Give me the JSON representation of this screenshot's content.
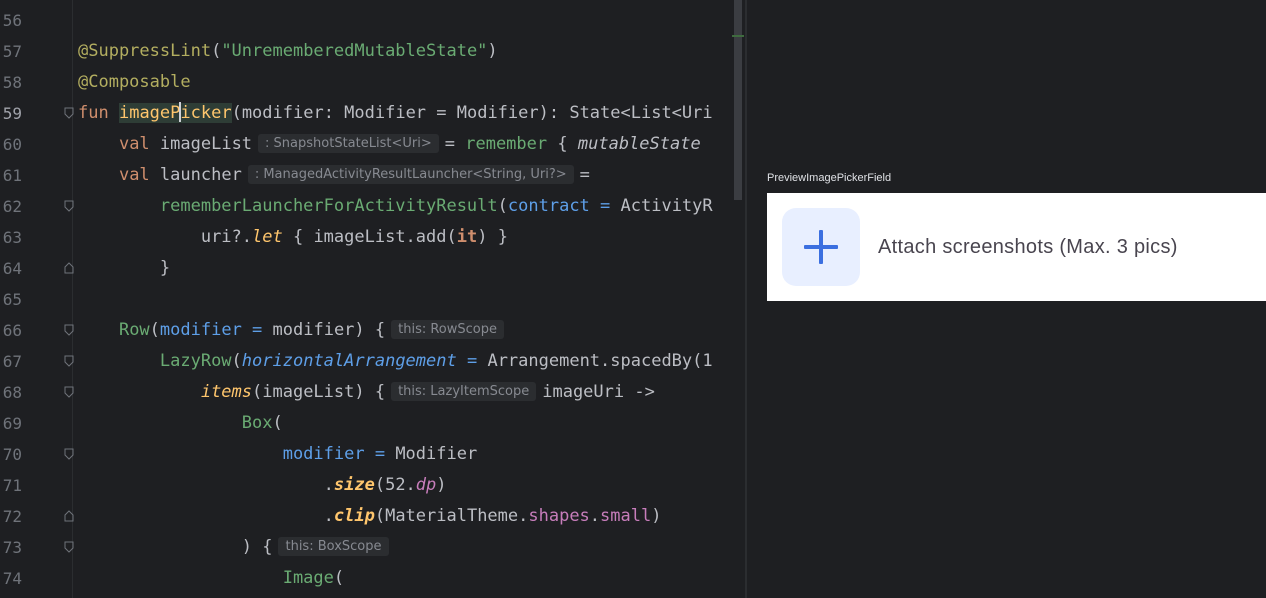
{
  "editor": {
    "lines": [
      {
        "num": "56"
      },
      {
        "num": "57",
        "annotation": "@SuppressLint",
        "p1": "(",
        "str": "\"UnrememberedMutableState\"",
        "p2": ")"
      },
      {
        "num": "58",
        "annotation": "@Composable"
      },
      {
        "num": "59",
        "kw": "fun",
        "fn_a": "imageP",
        "fn_b": "icker",
        "rest": "(modifier: Modifier = Modifier): State<List<Uri"
      },
      {
        "num": "60",
        "kw": "val",
        "name": "imageList",
        "hint": ": SnapshotStateList<Uri>",
        "eq": "=",
        "call": "remember",
        "brace": "{",
        "it": "mutableState"
      },
      {
        "num": "61",
        "kw": "val",
        "name": "launcher",
        "hint": ": ManagedActivityResultLauncher<String, Uri?>",
        "eq": "="
      },
      {
        "num": "62",
        "call": "rememberLauncherForActivityResult",
        "p": "(",
        "param": "contract",
        "eq": " = ",
        "rest": "ActivityR"
      },
      {
        "num": "63",
        "a": "uri?.",
        "let": "let",
        "b": " { imageList.add(",
        "kw": "it",
        "c": ") }"
      },
      {
        "num": "64",
        "text": "}"
      },
      {
        "num": "65"
      },
      {
        "num": "66",
        "call": "Row",
        "p": "(",
        "param": "modifier",
        "eq": " = ",
        "rest": "modifier) {",
        "hint": "this: RowScope"
      },
      {
        "num": "67",
        "call": "LazyRow",
        "p": "(",
        "param": "horizontalArrangement",
        "eq": " = ",
        "rest": "Arrangement.spacedBy(1"
      },
      {
        "num": "68",
        "call": "items",
        "rest": "(imageList) {",
        "hint": "this: LazyItemScope",
        "after": "imageUri ->"
      },
      {
        "num": "69",
        "call": "Box",
        "rest": "("
      },
      {
        "num": "70",
        "param": "modifier",
        "eq": " = ",
        "rest": "Modifier"
      },
      {
        "num": "71",
        "dot": ".",
        "call": "size",
        "a": "(52.",
        "prop": "dp",
        "b": ")"
      },
      {
        "num": "72",
        "dot": ".",
        "call": "clip",
        "a": "(MaterialTheme.",
        "prop": "shapes",
        "b": ".",
        "prop2": "small",
        "c": ")"
      },
      {
        "num": "73",
        "text": ") {",
        "hint": "this: BoxScope"
      },
      {
        "num": "74",
        "call": "Image",
        "rest": "("
      }
    ]
  },
  "preview": {
    "label": "PreviewImagePickerField",
    "attach_text": "Attach screenshots (Max. 3 pics)",
    "icon": "plus-icon",
    "colors": {
      "accent": "#3b6fe0",
      "button_bg": "#e8efff",
      "card_bg": "#ffffff"
    }
  }
}
